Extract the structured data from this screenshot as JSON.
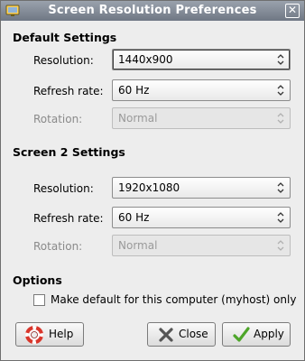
{
  "window": {
    "title": "Screen Resolution Preferences",
    "close_glyph": "✕"
  },
  "sections": {
    "default": {
      "title": "Default Settings",
      "resolution_label": "Resolution:",
      "resolution_value": "1440x900",
      "refresh_label": "Refresh rate:",
      "refresh_value": "60 Hz",
      "rotation_label": "Rotation:",
      "rotation_value": "Normal"
    },
    "screen2": {
      "title": "Screen 2 Settings",
      "resolution_label": "Resolution:",
      "resolution_value": "1920x1080",
      "refresh_label": "Refresh rate:",
      "refresh_value": "60 Hz",
      "rotation_label": "Rotation:",
      "rotation_value": "Normal"
    }
  },
  "options": {
    "title": "Options",
    "make_default_label": "Make default for this computer (myhost) only",
    "make_default_checked": false
  },
  "buttons": {
    "help": "Help",
    "close": "Close",
    "apply": "Apply"
  },
  "icons": {
    "app": "monitor-icon",
    "window_close": "close-icon",
    "combo": "combo-arrows-icon",
    "help": "lifebuoy-icon",
    "close": "x-close-icon",
    "apply": "checkmark-icon"
  },
  "colors": {
    "titlebar": "#7a828e",
    "help_icon": "#d9362b",
    "apply_icon": "#4ea62a",
    "close_icon": "#555555"
  }
}
